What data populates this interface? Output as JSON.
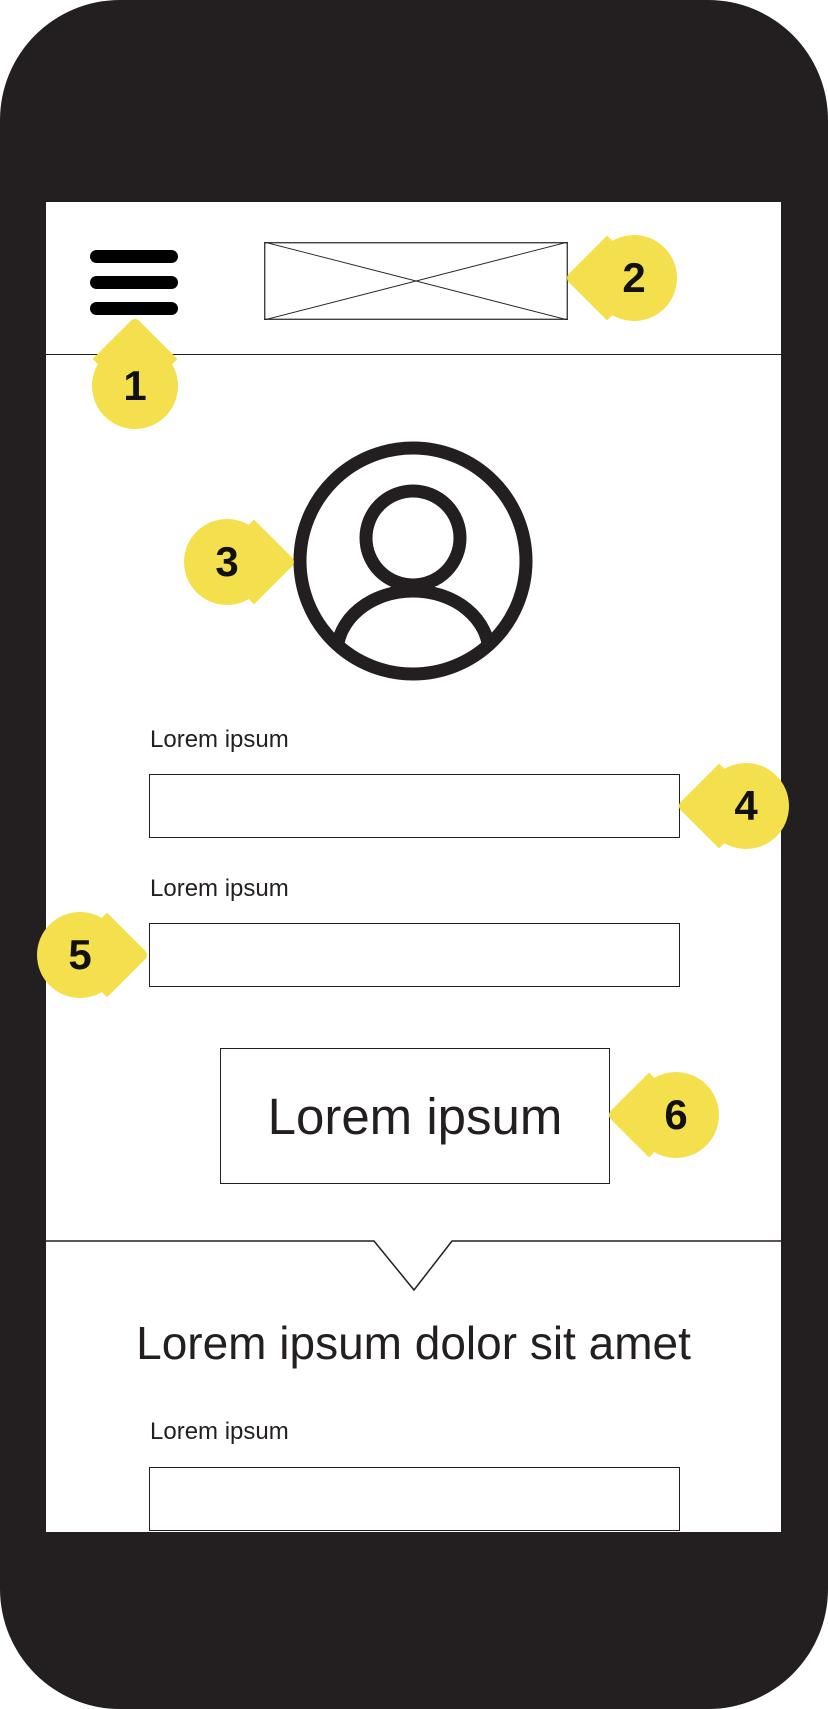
{
  "header": {
    "menu_icon": "hamburger-menu-icon",
    "logo_icon": "image-placeholder-icon"
  },
  "profile": {
    "avatar_icon": "user-avatar-icon"
  },
  "form": {
    "field1_label": "Lorem ipsum",
    "field1_value": "",
    "field2_label": "Lorem ipsum",
    "field2_value": "",
    "submit_label": "Lorem ipsum"
  },
  "section2": {
    "title": "Lorem ipsum dolor sit amet",
    "field_label": "Lorem ipsum",
    "field_value": ""
  },
  "annotations": [
    "1",
    "2",
    "3",
    "4",
    "5",
    "6"
  ],
  "colors": {
    "device": "#231f20",
    "screen": "#ffffff",
    "annotation_marker": "#f4e04d",
    "outline": "#231f20"
  }
}
